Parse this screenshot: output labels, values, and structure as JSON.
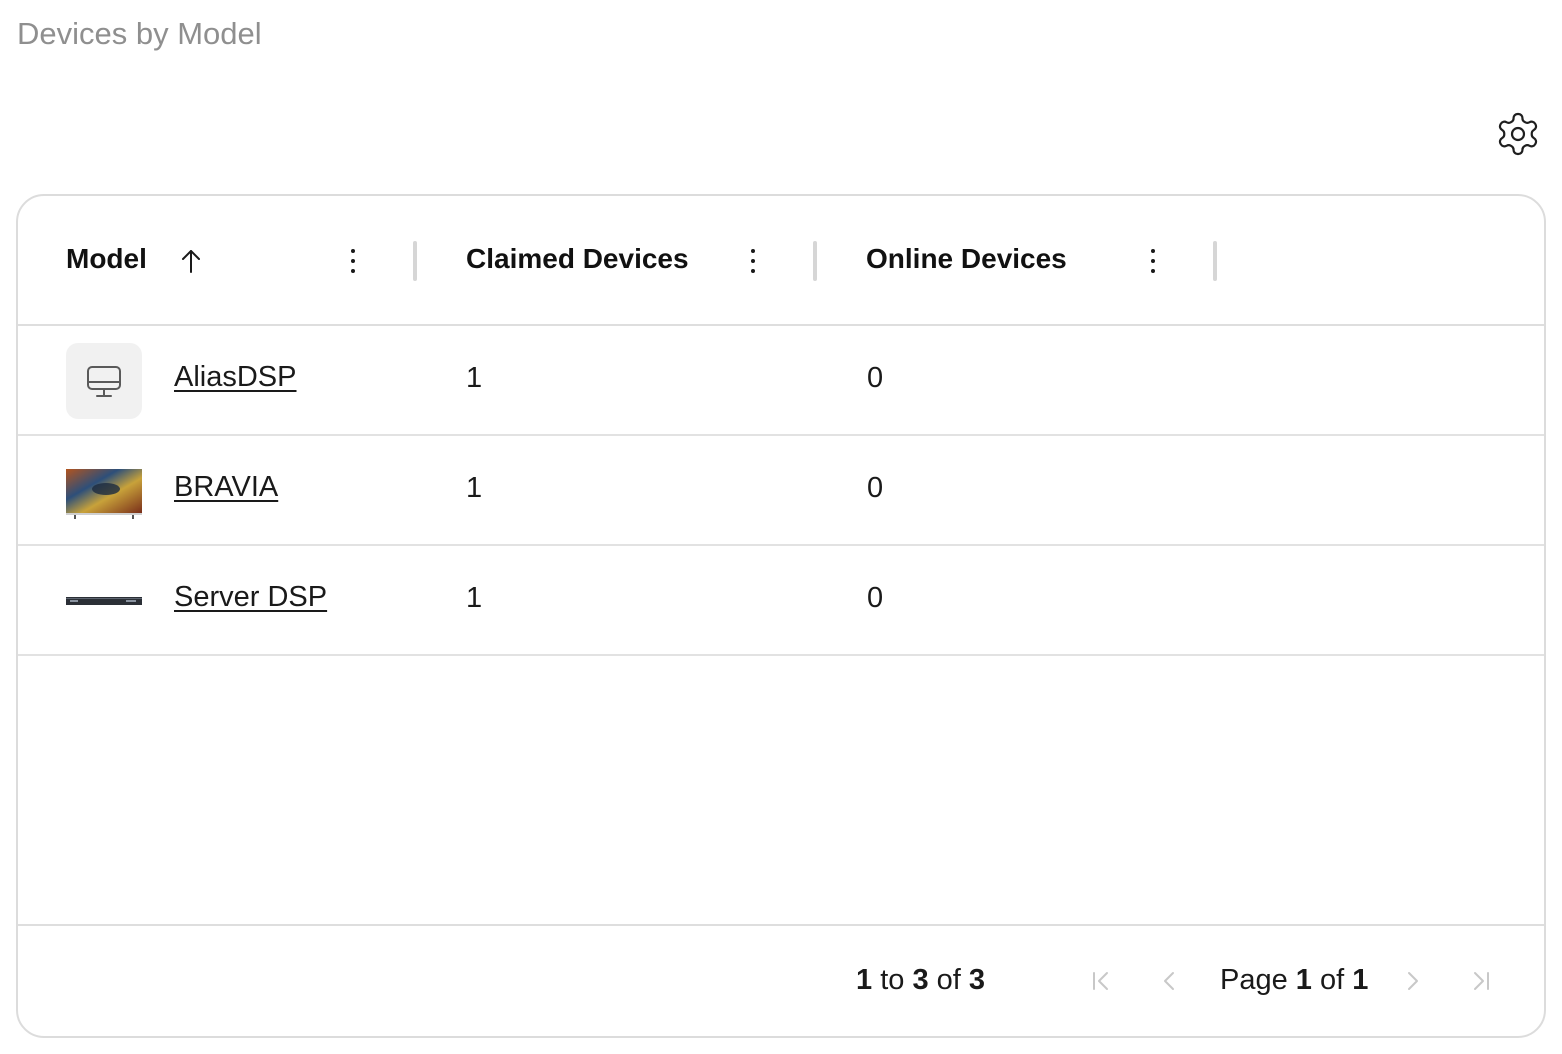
{
  "page": {
    "title": "Devices by Model"
  },
  "icons": {
    "settings": "gear-icon",
    "sort": "arrow-up-icon",
    "column_menu": "vertical-dots-icon",
    "placeholder": "monitor-icon"
  },
  "columns": [
    {
      "label": "Model",
      "sorted": "ascending"
    },
    {
      "label": "Claimed Devices"
    },
    {
      "label": "Online Devices"
    }
  ],
  "rows": [
    {
      "model": "AliasDSP",
      "claimed": "1",
      "online": "0",
      "thumbnail": "monitor-placeholder"
    },
    {
      "model": "BRAVIA",
      "claimed": "1",
      "online": "0",
      "thumbnail": "tv-image"
    },
    {
      "model": "Server DSP",
      "claimed": "1",
      "online": "0",
      "thumbnail": "rack-server-image"
    }
  ],
  "pagination": {
    "range_start": "1",
    "range_to": "to",
    "range_end": "3",
    "range_of": "of",
    "total": "3",
    "page_word": "Page",
    "page_current": "1",
    "page_of": "of",
    "page_total": "1"
  },
  "colors": {
    "title": "#8f8f8f",
    "border": "#dcdcdc",
    "text": "#1a1a1a",
    "disabled": "#c8c8c8"
  }
}
